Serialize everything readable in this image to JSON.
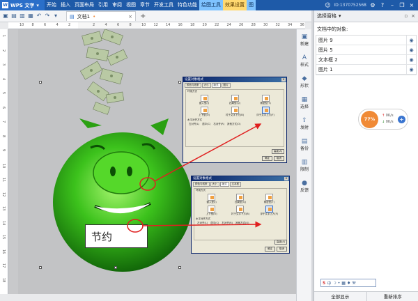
{
  "app": {
    "name": "WPS 文字",
    "account": "ID:1370752568",
    "brand_color": "#1e5aa8"
  },
  "menu": {
    "items": [
      "开始",
      "插入",
      "页面布局",
      "引用",
      "审阅",
      "视图",
      "章节",
      "开发工具",
      "特色功能"
    ],
    "context_tabs": [
      "绘图工具",
      "效果设置",
      "图"
    ]
  },
  "document": {
    "tab_title": "文档1",
    "new_tab_glyph": "+",
    "close_glyph": "×"
  },
  "ruler": {
    "h_labels": [
      "10",
      "8",
      "6",
      "4",
      "2",
      "",
      "2",
      "4",
      "6",
      "8",
      "10",
      "12",
      "14",
      "16",
      "18",
      "20",
      "22",
      "24",
      "26",
      "28",
      "30",
      "32",
      "34",
      "36"
    ],
    "v_labels": [
      "1",
      "2",
      "3",
      "4",
      "5",
      "6",
      "7",
      "8",
      "9",
      "10",
      "11",
      "12",
      "13",
      "14",
      "15",
      "16",
      "17",
      "18"
    ]
  },
  "textbox": {
    "text": "节约"
  },
  "dialog1": {
    "title": "设置对象格式",
    "tabs": [
      "颜色与线条",
      "大小",
      "版式",
      "图片"
    ],
    "group_label": "环绕方式",
    "options": [
      "嵌入型(I)",
      "四周型(Q)",
      "紧密型(T)",
      "上下型(O)",
      "衬于文字下方(B)",
      "浮于文字上方(F)"
    ],
    "selected_option": 5,
    "halign_label": "水平对齐方式",
    "halign": [
      "左对齐(L)",
      "居中(C)",
      "右对齐(R)",
      "其他方式(O)"
    ],
    "advanced": "高级(A)",
    "ok": "确定",
    "cancel": "取消"
  },
  "dialog2": {
    "title": "设置对象格式",
    "tabs": [
      "颜色与线条",
      "大小",
      "版式",
      "文本框"
    ],
    "group_label": "环绕方式",
    "options": [
      "嵌入型(I)",
      "四周型(Q)",
      "紧密型(T)",
      "上下型(O)",
      "衬于文字下方(B)",
      "浮于文字上方(F)"
    ],
    "selected_option": 5,
    "halign_label": "水平对齐方式",
    "halign": [
      "左对齐(L)",
      "居中(C)",
      "右对齐(R)",
      "其他方式(O)"
    ],
    "advanced": "高级(A)",
    "ok": "确定",
    "cancel": "取消"
  },
  "vtoolbar": {
    "items": [
      {
        "label": "新建",
        "icon": "new-icon"
      },
      {
        "label": "样式",
        "icon": "style-icon"
      },
      {
        "label": "形状",
        "icon": "shape-icon"
      },
      {
        "label": "选择",
        "icon": "select-icon"
      },
      {
        "label": "发射",
        "icon": "send-icon"
      },
      {
        "label": "备份",
        "icon": "backup-icon"
      },
      {
        "label": "限制",
        "icon": "restrict-icon"
      },
      {
        "label": "反馈",
        "icon": "feedback-icon"
      }
    ]
  },
  "pane": {
    "title": "选择窗格",
    "subtitle": "文档中的对象:",
    "objects": [
      "图片 9",
      "图片 5",
      "文本框 2",
      "图片 1"
    ],
    "show_all": "全部显示",
    "reorder": "重新排序"
  },
  "speed_widget": {
    "percent": "77%",
    "up": "0K/s",
    "down": "0K/s"
  },
  "colors": {
    "pig_green": "#3cc21c",
    "arrow_red": "#e02020",
    "highlight_orange": "#f08a36"
  }
}
